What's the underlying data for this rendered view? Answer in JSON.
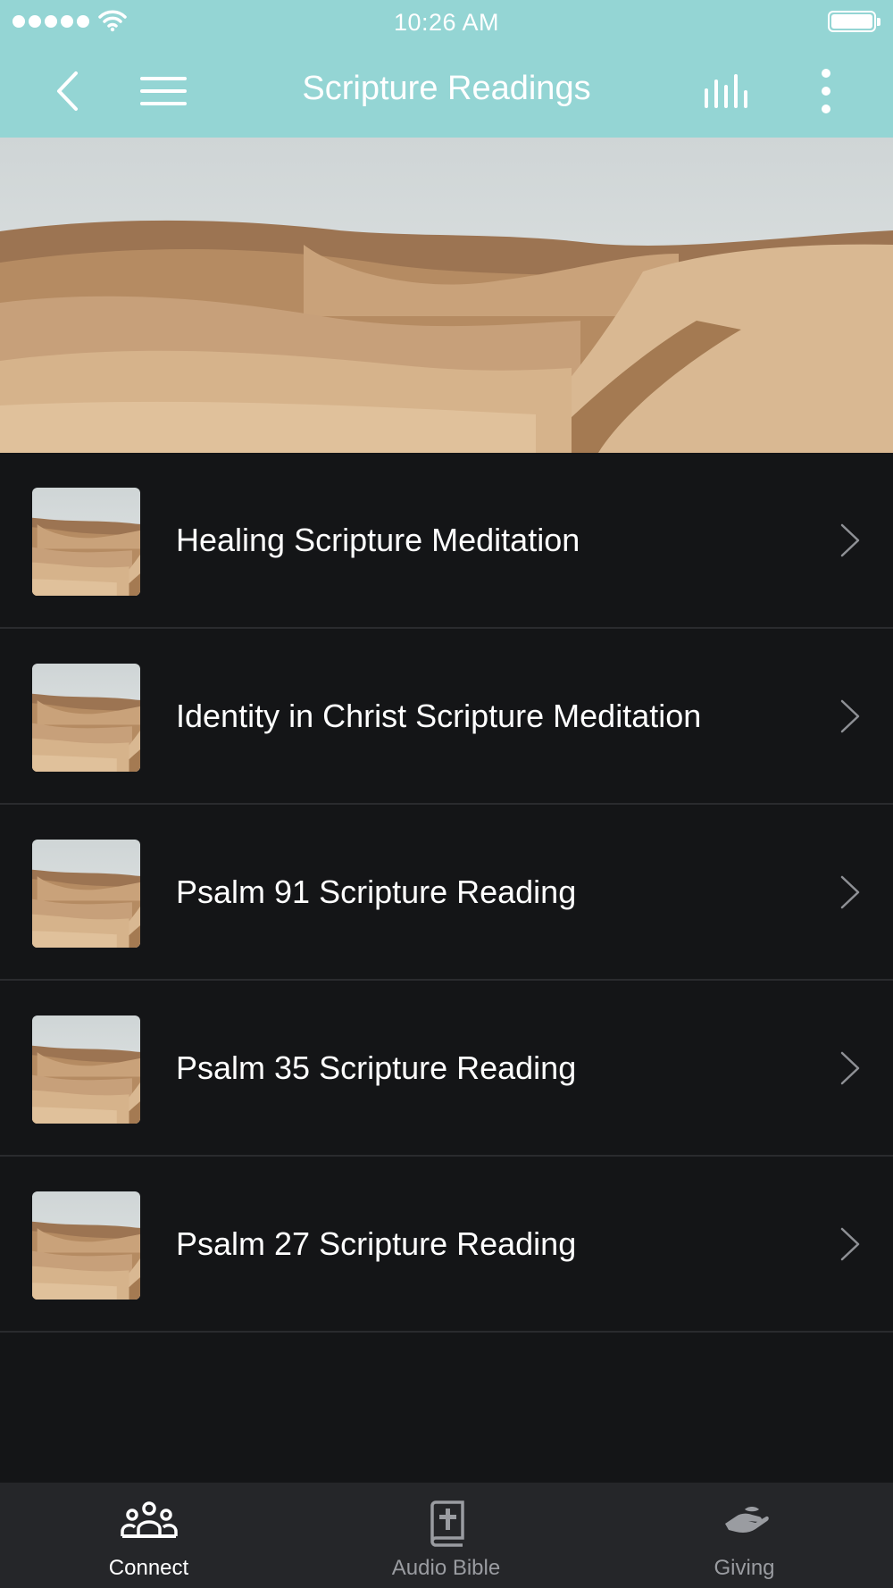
{
  "status_bar": {
    "time": "10:26 AM"
  },
  "nav": {
    "title": "Scripture Readings"
  },
  "items": [
    {
      "label": "Healing Scripture Meditation"
    },
    {
      "label": "Identity in Christ Scripture Meditation"
    },
    {
      "label": "Psalm 91 Scripture Reading"
    },
    {
      "label": "Psalm 35 Scripture Reading"
    },
    {
      "label": "Psalm 27 Scripture Reading"
    }
  ],
  "tabs": [
    {
      "label": "Connect",
      "icon": "group-icon",
      "active": true
    },
    {
      "label": "Audio Bible",
      "icon": "bible-icon",
      "active": false
    },
    {
      "label": "Giving",
      "icon": "giving-hand-icon",
      "active": false
    }
  ],
  "colors": {
    "header": "#94d5d4",
    "list_background": "#141517",
    "tab_bar": "#252629",
    "active_tab": "#ffffff",
    "inactive_tab": "#9a9ca1"
  }
}
